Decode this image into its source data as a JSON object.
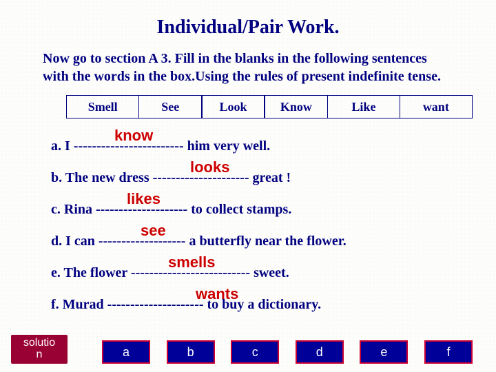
{
  "title": "Individual/Pair Work.",
  "instructions": "Now go to section A 3. Fill in the blanks in the following sentences with the words in the box.Using the rules of present indefinite tense.",
  "word_box": [
    "Smell",
    "See",
    "Look",
    "Know",
    "Like",
    "want"
  ],
  "sentences": {
    "a": "a.  I ------------------------ him very well.",
    "b": "b.  The new dress --------------------- great !",
    "c": "c.  Rina -------------------- to collect stamps.",
    "d": "d.  I can ------------------- a butterfly near the flower.",
    "e": "e.  The flower -------------------------- sweet.",
    "f": "f.  Murad --------------------- to buy a dictionary."
  },
  "answers": {
    "a": "know",
    "b": "looks",
    "c": "likes",
    "d": "see",
    "e": "smells",
    "f": "wants"
  },
  "solution_label": "solutio\nn",
  "answer_buttons": [
    "a",
    "b",
    "c",
    "d",
    "e",
    "f"
  ]
}
